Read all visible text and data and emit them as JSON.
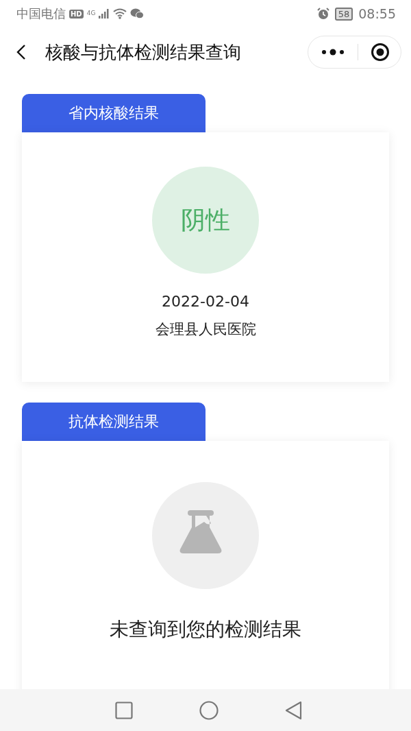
{
  "status_bar": {
    "carrier": "中国电信",
    "hd": "HD",
    "network": "4G",
    "battery": "58",
    "time": "08:55"
  },
  "nav": {
    "title": "核酸与抗体检测结果查询"
  },
  "sections": [
    {
      "kind": "result",
      "tab": "省内核酸结果",
      "result": "阴性",
      "date": "2022-02-04",
      "hospital": "会理县人民医院"
    },
    {
      "kind": "empty",
      "tab": "抗体检测结果",
      "message": "未查询到您的检测结果"
    }
  ]
}
